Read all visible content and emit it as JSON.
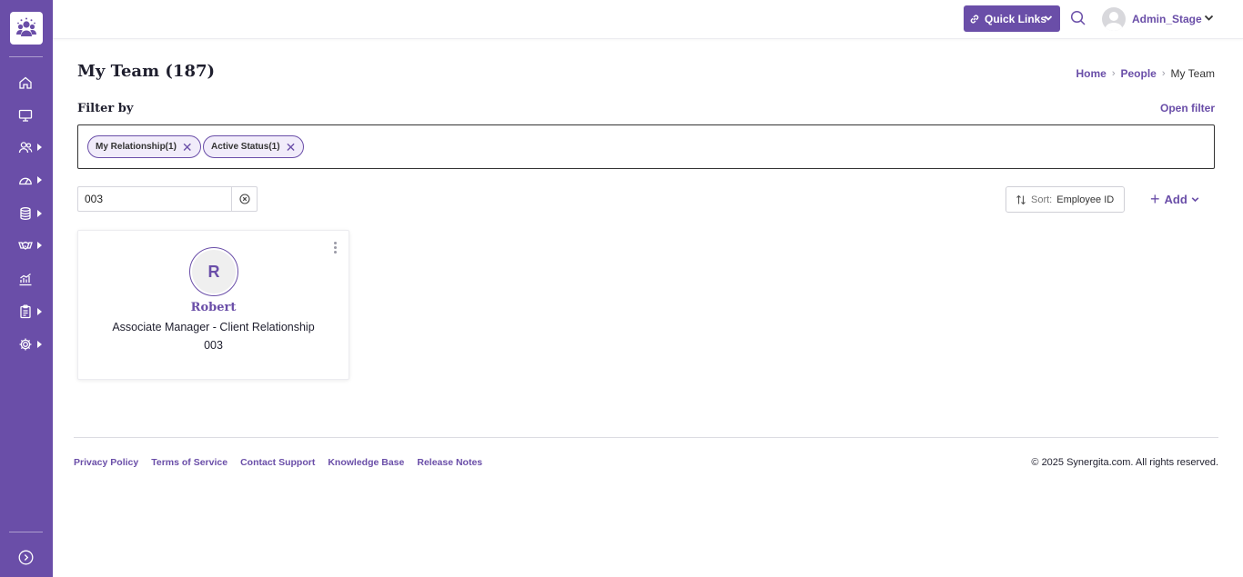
{
  "sidebar": {
    "items": [
      {
        "icon": "home-icon",
        "has_submenu": false
      },
      {
        "icon": "monitor-icon",
        "has_submenu": false
      },
      {
        "icon": "people-icon",
        "has_submenu": true
      },
      {
        "icon": "dashboard-gauge-icon",
        "has_submenu": true
      },
      {
        "icon": "database-icon",
        "has_submenu": true
      },
      {
        "icon": "handshake-icon",
        "has_submenu": true
      },
      {
        "icon": "analytics-chart-icon",
        "has_submenu": false
      },
      {
        "icon": "clipboard-icon",
        "has_submenu": true
      },
      {
        "icon": "settings-gear-icon",
        "has_submenu": true
      }
    ],
    "expand_icon": "expand-chevron-icon",
    "accent_color": "#6a4ea8"
  },
  "topbar": {
    "quick_links_label": "Quick Links",
    "user_name": "Admin_Stage"
  },
  "page": {
    "title": "My Team (187)",
    "breadcrumb": {
      "home": "Home",
      "people": "People",
      "current": "My Team"
    }
  },
  "filter": {
    "label": "Filter by",
    "open_filter": "Open filter",
    "chips": [
      {
        "label": "My Relationship(1)"
      },
      {
        "label": "Active Status(1)"
      }
    ]
  },
  "search": {
    "value": "003"
  },
  "sort": {
    "label": "Sort:",
    "value": "Employee ID"
  },
  "add_label": "Add",
  "cards": [
    {
      "initial": "R",
      "name": "Robert",
      "role": "Associate Manager - Client Relationship",
      "employee_id": "003"
    }
  ],
  "footer": {
    "links": [
      "Privacy Policy",
      "Terms of Service",
      "Contact Support",
      "Knowledge Base",
      "Release Notes"
    ],
    "copyright": "© 2025 Synergita.com. All rights reserved."
  }
}
